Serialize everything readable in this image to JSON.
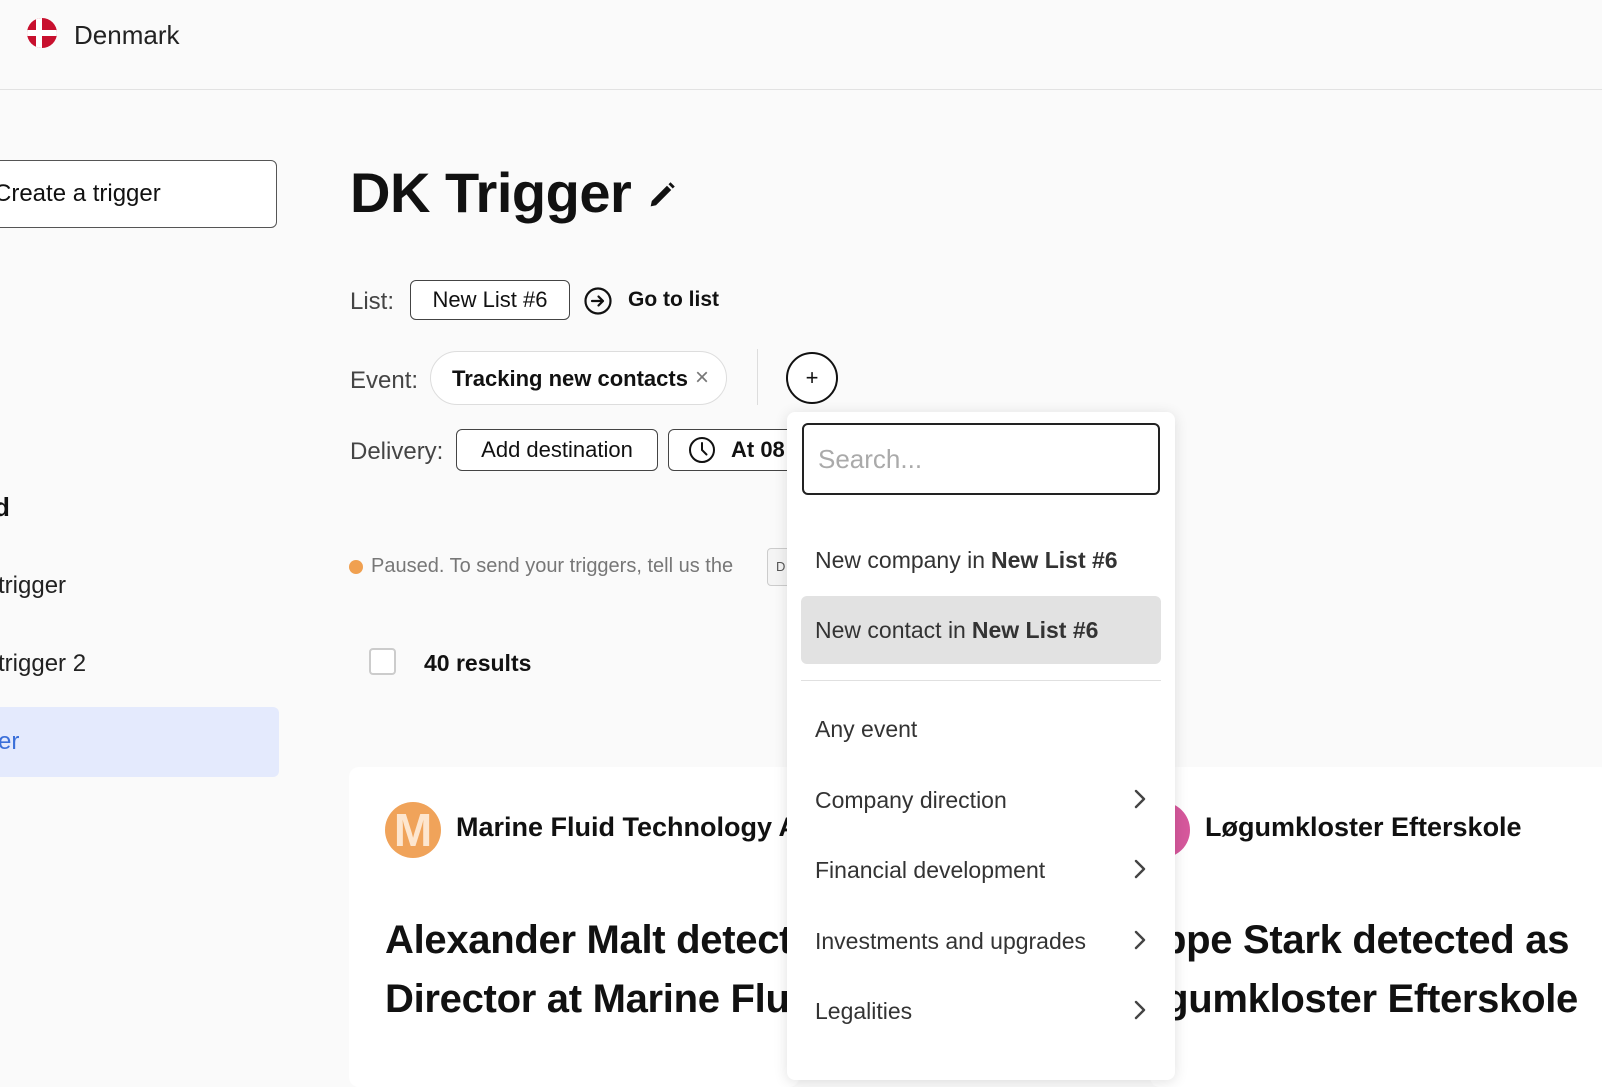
{
  "topbar": {
    "country": "Denmark"
  },
  "sidebar": {
    "create_label": "Create a trigger",
    "section_head": "d",
    "items": [
      {
        "label": "trigger"
      },
      {
        "label": "trigger 2"
      },
      {
        "label": "er"
      }
    ]
  },
  "main": {
    "title": "DK Trigger",
    "list_label": "List:",
    "list_value": "New List #6",
    "goto_label": "Go to list",
    "event_label": "Event:",
    "event_value": "Tracking new contacts",
    "event_remove": "×",
    "add_event": "+",
    "delivery_label": "Delivery:",
    "add_destination": "Add destination",
    "time_label": "At 08",
    "paused_text": "Paused. To send your triggers, tell us the",
    "mini_badge": "D",
    "results": "40 results"
  },
  "cards": [
    {
      "avatar_letter": "M",
      "company": "Marine Fluid Technology A",
      "headline_line1": "Alexander Malt detect",
      "headline_line2": "Director at Marine Flui"
    },
    {
      "company": "Løgumkloster Efterskole",
      "headline_line1": "eppe Stark detected as",
      "headline_line2": "ogumkloster Efterskole"
    }
  ],
  "dropdown": {
    "search_placeholder": "Search...",
    "items": [
      {
        "prefix": "New company in",
        "bold": "New List #6"
      },
      {
        "prefix": "New contact in",
        "bold": "New List #6"
      },
      {
        "label": "Any event"
      },
      {
        "label": "Company direction"
      },
      {
        "label": "Financial development"
      },
      {
        "label": "Investments and upgrades"
      },
      {
        "label": "Legalities"
      }
    ]
  },
  "colors": {
    "accent_blue": "#3b6fd9",
    "active_bg": "#e4eafd",
    "paused_dot": "#f0a050",
    "flag_red": "#c8102e",
    "avatar1": "#f0a35a",
    "avatar2": "#d6589c"
  }
}
